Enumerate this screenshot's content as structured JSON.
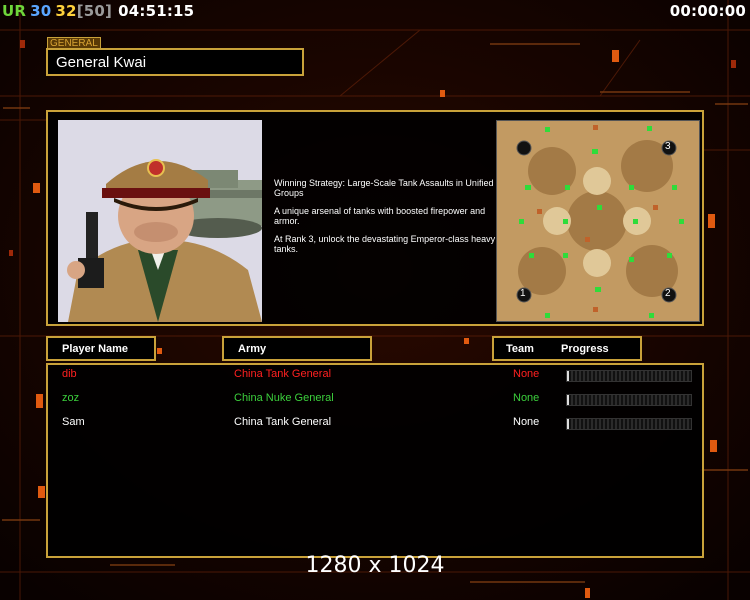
{
  "hud": {
    "ur_label": "UR",
    "val_a": "30",
    "val_b": "32",
    "val_c": "[50]",
    "clock": "04:51:15",
    "timer": "00:00:00"
  },
  "general": {
    "tag": "GENERAL",
    "name": "General Kwai"
  },
  "description": [
    "Winning Strategy: Large-Scale Tank Assaults in Unified Groups",
    "A unique arsenal of tanks with boosted firepower and armor.",
    "At Rank 3, unlock the devastating Emperor-class heavy tanks."
  ],
  "minimap": {
    "start_positions": [
      "1",
      "2",
      "3"
    ]
  },
  "columns": {
    "player_name": "Player Name",
    "army": "Army",
    "team": "Team",
    "progress": "Progress"
  },
  "players": [
    {
      "name": "dib",
      "army": "China Tank General",
      "team": "None",
      "color": "#ff2020",
      "progress": 0.01
    },
    {
      "name": "zoz",
      "army": "China Nuke General",
      "team": "None",
      "color": "#3ccf3c",
      "progress": 0.01
    },
    {
      "name": "Sam",
      "army": "China Tank General",
      "team": "None",
      "color": "#ffffff",
      "progress": 0.01
    }
  ],
  "resolution_label": "1280 x 1024",
  "colors": {
    "accent_gold": "#c9a23a",
    "background": "#0a0100"
  }
}
